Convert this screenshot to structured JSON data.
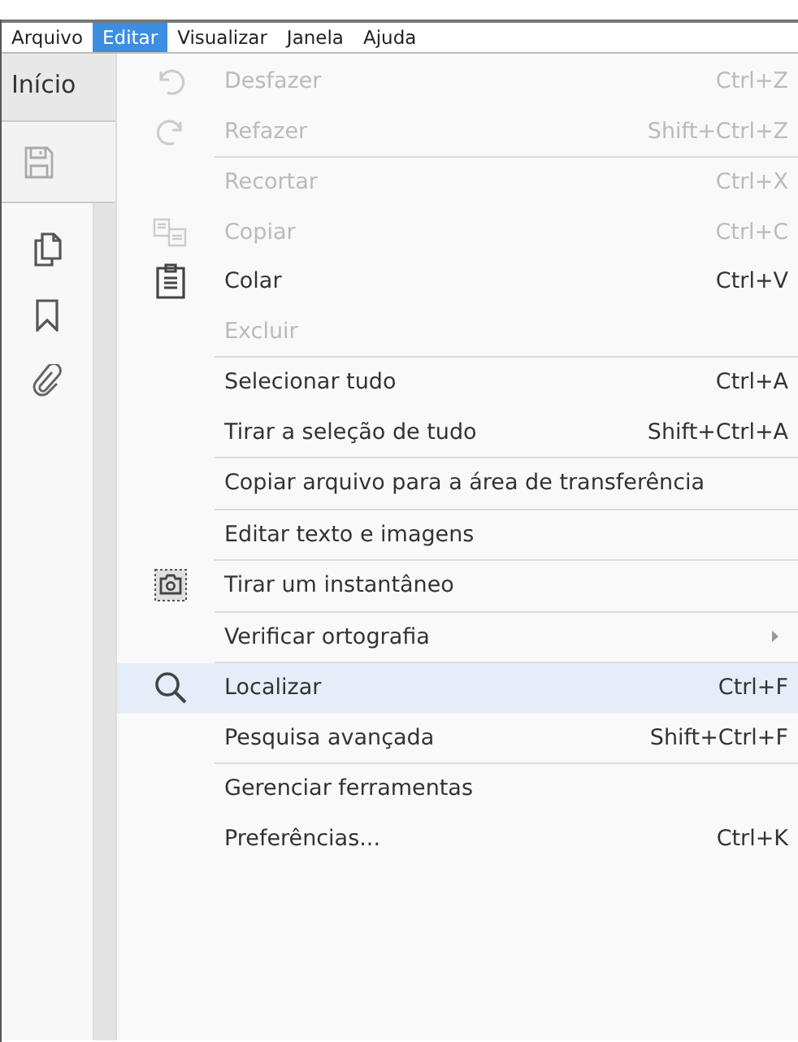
{
  "menubar": [
    {
      "label": "Arquivo",
      "selected": false
    },
    {
      "label": "Editar",
      "selected": true
    },
    {
      "label": "Visualizar",
      "selected": false
    },
    {
      "label": "Janela",
      "selected": false
    },
    {
      "label": "Ajuda",
      "selected": false
    }
  ],
  "home_tab": {
    "label": "Início"
  },
  "menu": [
    {
      "kind": "item",
      "label": "Desfazer",
      "shortcut": "Ctrl+Z",
      "disabled": true
    },
    {
      "kind": "item",
      "label": "Refazer",
      "shortcut": "Shift+Ctrl+Z",
      "disabled": true
    },
    {
      "kind": "separator"
    },
    {
      "kind": "item",
      "label": "Recortar",
      "shortcut": "Ctrl+X",
      "disabled": true
    },
    {
      "kind": "item",
      "label": "Copiar",
      "shortcut": "Ctrl+C",
      "disabled": true
    },
    {
      "kind": "item",
      "label": "Colar",
      "shortcut": "Ctrl+V",
      "disabled": false
    },
    {
      "kind": "item",
      "label": "Excluir",
      "disabled": true
    },
    {
      "kind": "separator"
    },
    {
      "kind": "item",
      "label": "Selecionar tudo",
      "shortcut": "Ctrl+A",
      "disabled": false
    },
    {
      "kind": "item",
      "label": "Tirar a seleção de tudo",
      "shortcut": "Shift+Ctrl+A",
      "disabled": false
    },
    {
      "kind": "separator"
    },
    {
      "kind": "item",
      "label": "Copiar arquivo para a área de transferência",
      "disabled": false
    },
    {
      "kind": "separator"
    },
    {
      "kind": "item",
      "label": "Editar texto e imagens",
      "disabled": false
    },
    {
      "kind": "separator"
    },
    {
      "kind": "item",
      "label": "Tirar um instantâneo",
      "disabled": false
    },
    {
      "kind": "separator"
    },
    {
      "kind": "item",
      "label": "Verificar ortografia",
      "disabled": false,
      "submenu": true
    },
    {
      "kind": "separator"
    },
    {
      "kind": "item",
      "label": "Localizar",
      "shortcut": "Ctrl+F",
      "disabled": false,
      "selected": true
    },
    {
      "kind": "item",
      "label": "Pesquisa avançada",
      "shortcut": "Shift+Ctrl+F",
      "disabled": false
    },
    {
      "kind": "separator"
    },
    {
      "kind": "item",
      "label": "Gerenciar ferramentas",
      "disabled": false
    },
    {
      "kind": "item",
      "label": "Preferências...",
      "shortcut": "Ctrl+K",
      "disabled": false
    }
  ]
}
